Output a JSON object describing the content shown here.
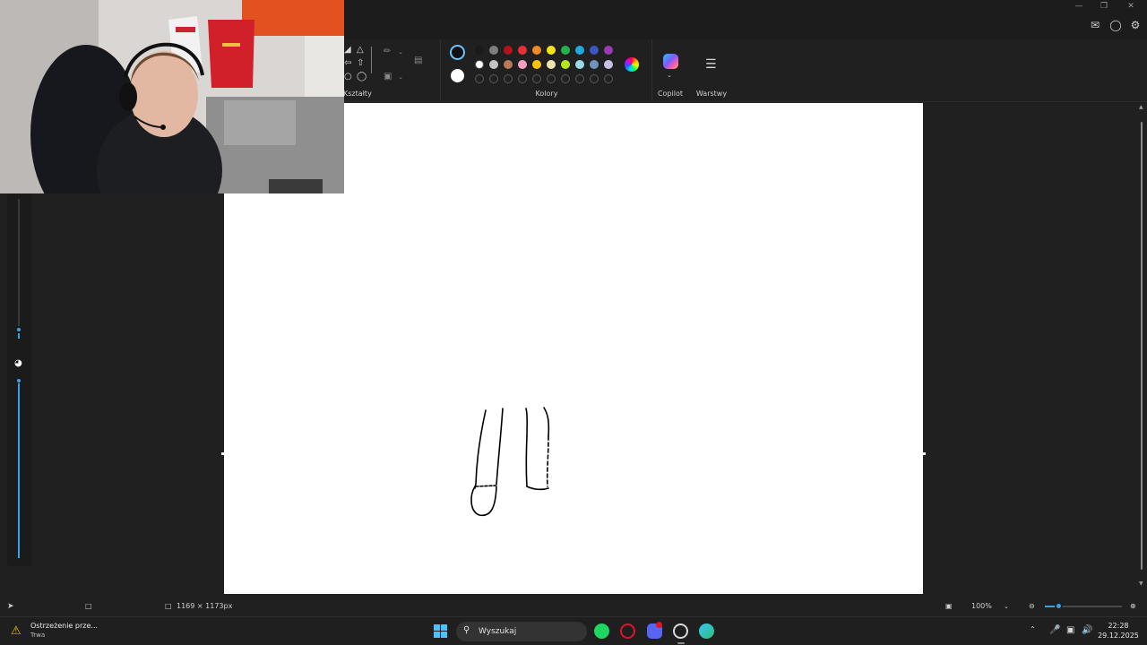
{
  "ribbon": {
    "shapes_label": "Kształty",
    "colors_label": "Kolory",
    "copilot_label": "Copilot",
    "layers_label": "Warstwy",
    "palette_row1": [
      "#1a1a1a",
      "#7f7f7f",
      "#b5121b",
      "#e5303a",
      "#f08a24",
      "#f7e31a",
      "#25b14c",
      "#21a9df",
      "#3a56c4",
      "#9b3bb3"
    ],
    "palette_row2": [
      "#ffffff",
      "#c3c3c3",
      "#b97a57",
      "#f5a0c3",
      "#f9c20f",
      "#efe4b0",
      "#b5e61d",
      "#99d9ea",
      "#7092be",
      "#c8bfe7"
    ],
    "current_color": "#111111",
    "secondary_color": "#ffffff"
  },
  "canvas": {
    "background": "#ffffff",
    "drawing": "freehand-sketch"
  },
  "statusbar": {
    "canvas_size": "1169 × 1173px",
    "zoom": "100%"
  },
  "taskbar": {
    "notification_title": "Ostrzeżenie prze...",
    "notification_subtitle": "Trwa",
    "search_placeholder": "Wyszukaj",
    "time": "22:28",
    "date": "29.12.2025"
  }
}
